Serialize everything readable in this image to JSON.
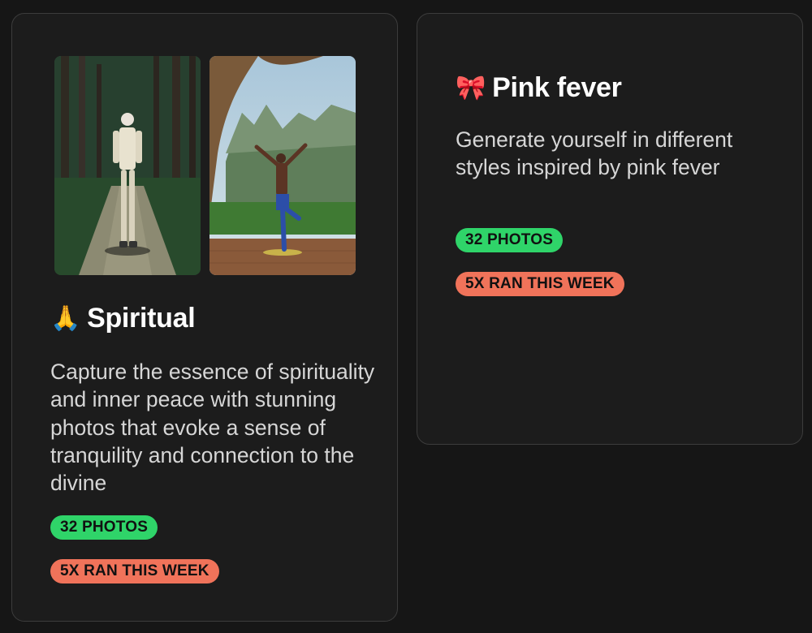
{
  "cards": [
    {
      "emoji": "🙏",
      "title": "Spiritual",
      "description": "Capture the essence of spirituality and inner peace with stunning photos that evoke a sense of tranquility and connection to the divine",
      "photos_badge": "32 PHOTOS",
      "runs_badge": "5X RAN THIS WEEK"
    },
    {
      "emoji": "🎀",
      "title": "Pink fever",
      "description": "Generate yourself in different styles inspired by pink fever",
      "photos_badge": "32 PHOTOS",
      "runs_badge": "5X RAN THIS WEEK"
    }
  ],
  "colors": {
    "photos_badge": "#2fd469",
    "runs_badge": "#f0735a",
    "card_background": "#1c1c1c",
    "page_background": "#161616"
  }
}
